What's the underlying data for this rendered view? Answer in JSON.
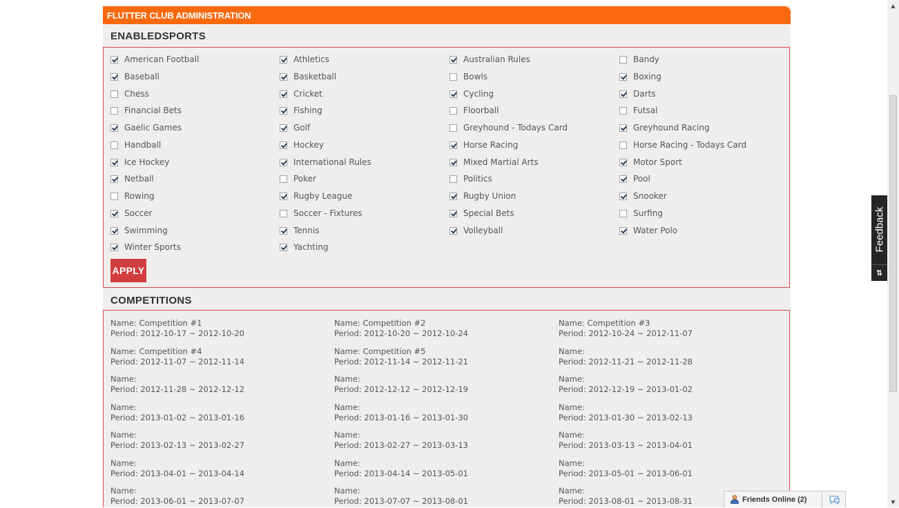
{
  "header": {
    "title": "FLUTTER CLUB ADMINISTRATION"
  },
  "enabled_sports": {
    "heading": "ENABLEDSPORTS",
    "apply_label": "APPLY",
    "columns": [
      [
        {
          "label": "American Football",
          "checked": true
        },
        {
          "label": "Baseball",
          "checked": true
        },
        {
          "label": "Chess",
          "checked": false
        },
        {
          "label": "Financial Bets",
          "checked": false
        },
        {
          "label": "Gaelic Games",
          "checked": true
        },
        {
          "label": "Handball",
          "checked": false
        },
        {
          "label": "Ice Hockey",
          "checked": true
        },
        {
          "label": "Netball",
          "checked": true
        },
        {
          "label": "Rowing",
          "checked": false
        },
        {
          "label": "Soccer",
          "checked": true
        },
        {
          "label": "Swimming",
          "checked": true
        },
        {
          "label": "Winter Sports",
          "checked": true
        }
      ],
      [
        {
          "label": "Athletics",
          "checked": true
        },
        {
          "label": "Basketball",
          "checked": true
        },
        {
          "label": "Cricket",
          "checked": true
        },
        {
          "label": "Fishing",
          "checked": true
        },
        {
          "label": "Golf",
          "checked": true
        },
        {
          "label": "Hockey",
          "checked": true
        },
        {
          "label": "International Rules",
          "checked": true
        },
        {
          "label": "Poker",
          "checked": false
        },
        {
          "label": "Rugby League",
          "checked": true
        },
        {
          "label": "Soccer - Fixtures",
          "checked": false
        },
        {
          "label": "Tennis",
          "checked": true
        },
        {
          "label": "Yachting",
          "checked": true
        }
      ],
      [
        {
          "label": "Australian Rules",
          "checked": true
        },
        {
          "label": "Bowls",
          "checked": false
        },
        {
          "label": "Cycling",
          "checked": true
        },
        {
          "label": "Floorball",
          "checked": false
        },
        {
          "label": "Greyhound - Todays Card",
          "checked": false
        },
        {
          "label": "Horse Racing",
          "checked": true
        },
        {
          "label": "Mixed Martial Arts",
          "checked": true
        },
        {
          "label": "Politics",
          "checked": false
        },
        {
          "label": "Rugby Union",
          "checked": true
        },
        {
          "label": "Special Bets",
          "checked": true
        },
        {
          "label": "Volleyball",
          "checked": true
        }
      ],
      [
        {
          "label": "Bandy",
          "checked": false
        },
        {
          "label": "Boxing",
          "checked": true
        },
        {
          "label": "Darts",
          "checked": true
        },
        {
          "label": "Futsal",
          "checked": false
        },
        {
          "label": "Greyhound Racing",
          "checked": true
        },
        {
          "label": "Horse Racing - Todays Card",
          "checked": false
        },
        {
          "label": "Motor Sport",
          "checked": true
        },
        {
          "label": "Pool",
          "checked": true
        },
        {
          "label": "Snooker",
          "checked": true
        },
        {
          "label": "Surfing",
          "checked": false
        },
        {
          "label": "Water Polo",
          "checked": true
        }
      ]
    ]
  },
  "competitions": {
    "heading": "COMPETITIONS",
    "items": [
      {
        "name": "Name: Competition #1",
        "period": "Period: 2012-10-17 ~ 2012-10-20"
      },
      {
        "name": "Name: Competition #2",
        "period": "Period: 2012-10-20 ~ 2012-10-24"
      },
      {
        "name": "Name: Competition #3",
        "period": "Period: 2012-10-24 ~ 2012-11-07"
      },
      {
        "name": "Name: Competition #4",
        "period": "Period: 2012-11-07 ~ 2012-11-14"
      },
      {
        "name": "Name: Competition #5",
        "period": "Period: 2012-11-14 ~ 2012-11-21"
      },
      {
        "name": "Name:",
        "period": "Period: 2012-11-21 ~ 2012-11-28"
      },
      {
        "name": "Name:",
        "period": "Period: 2012-11-28 ~ 2012-12-12"
      },
      {
        "name": "Name:",
        "period": "Period: 2012-12-12 ~ 2012-12-19"
      },
      {
        "name": "Name:",
        "period": "Period: 2012-12-19 ~ 2013-01-02"
      },
      {
        "name": "Name:",
        "period": "Period: 2013-01-02 ~ 2013-01-16"
      },
      {
        "name": "Name:",
        "period": "Period: 2013-01-16 ~ 2013-01-30"
      },
      {
        "name": "Name:",
        "period": "Period: 2013-01-30 ~ 2013-02-13"
      },
      {
        "name": "Name:",
        "period": "Period: 2013-02-13 ~ 2013-02-27"
      },
      {
        "name": "Name:",
        "period": "Period: 2013-02-27 ~ 2013-03-13"
      },
      {
        "name": "Name:",
        "period": "Period: 2013-03-13 ~ 2013-04-01"
      },
      {
        "name": "Name:",
        "period": "Period: 2013-04-01 ~ 2013-04-14"
      },
      {
        "name": "Name:",
        "period": "Period: 2013-04-14 ~ 2013-05-01"
      },
      {
        "name": "Name:",
        "period": "Period: 2013-05-01 ~ 2013-06-01"
      },
      {
        "name": "Name:",
        "period": "Period: 2013-06-01 ~ 2013-07-07"
      },
      {
        "name": "Name:",
        "period": "Period: 2013-07-07 ~ 2013-08-01"
      },
      {
        "name": "Name:",
        "period": "Period: 2013-08-01 ~ 2013-08-31"
      }
    ]
  },
  "feedback": {
    "label": "Feedback",
    "icon": "sliders-icon"
  },
  "friends_bar": {
    "label": "Friends Online (2)",
    "icon": "person-icon",
    "chat_icon": "chat-bubble-icon"
  },
  "colors": {
    "orange_bar": "#f9690e",
    "box_border": "#d6474a",
    "apply_button": "#d23e3f",
    "panel_bg": "#efeeec"
  }
}
